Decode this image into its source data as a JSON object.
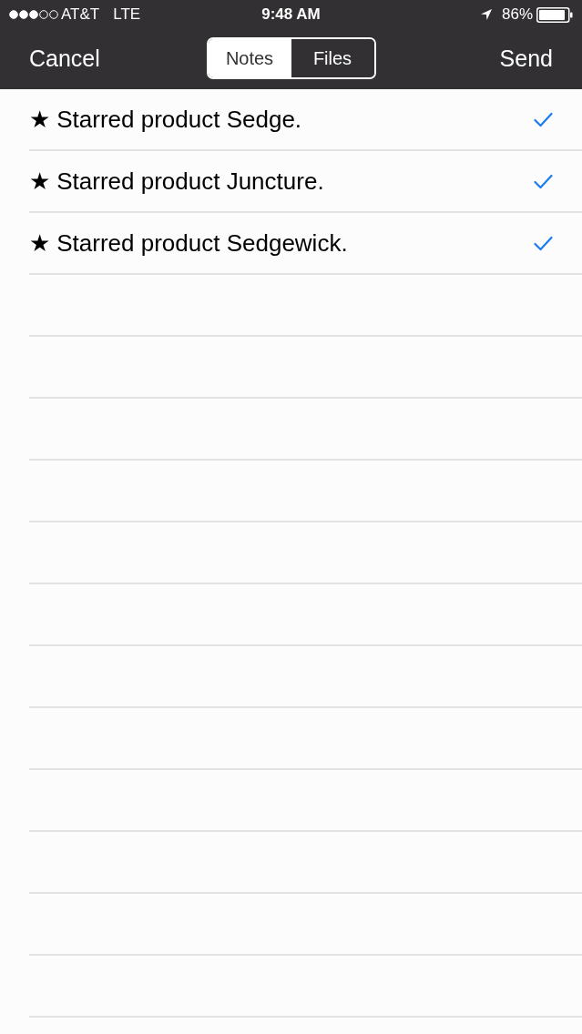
{
  "status_bar": {
    "carrier": "AT&T",
    "network": "LTE",
    "time": "9:48 AM",
    "battery": "86%"
  },
  "nav_bar": {
    "cancel": "Cancel",
    "send": "Send",
    "segments": [
      {
        "label": "Notes",
        "selected": true
      },
      {
        "label": "Files",
        "selected": false
      }
    ]
  },
  "items": [
    {
      "text": "★ Starred product Sedge.",
      "checked": true
    },
    {
      "text": "★ Starred product Juncture.",
      "checked": true
    },
    {
      "text": "★ Starred product Sedgewick.",
      "checked": true
    }
  ]
}
